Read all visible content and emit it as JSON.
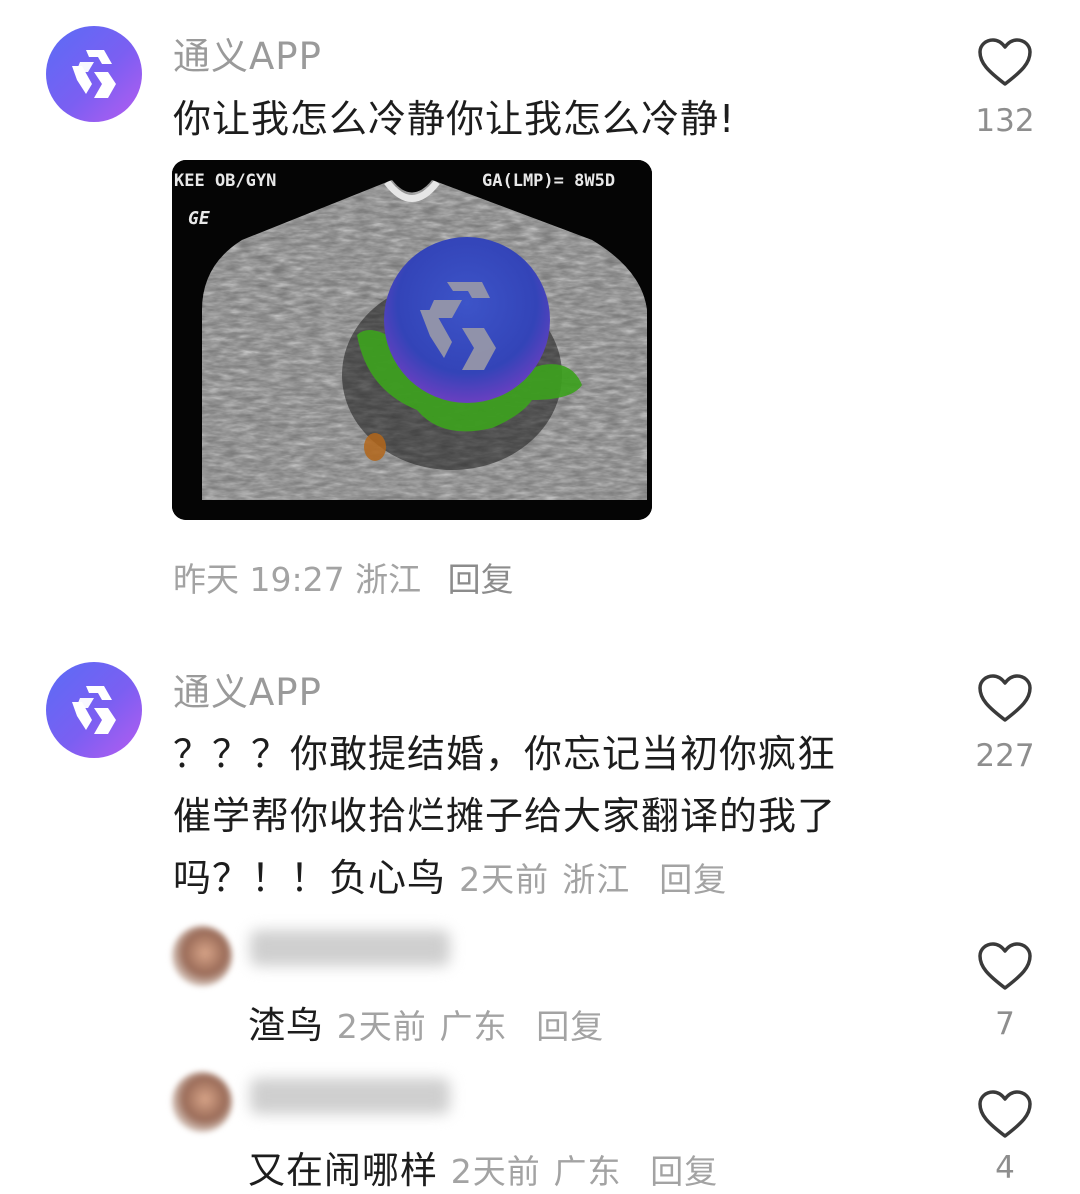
{
  "comments": [
    {
      "user": "通义APP",
      "text": "你让我怎么冷静你让我怎么冷静!",
      "time": "昨天 19:27",
      "location": "浙江",
      "reply_label": "回复",
      "likes": "132",
      "image": {
        "overlay_left": "KEE OB/GYN",
        "overlay_right": "GA(LMP)= 8W5D",
        "overlay_logo": "GE"
      }
    },
    {
      "user": "通义APP",
      "text": "？？？你敢提结婚，你忘记当初你疯狂催学帮你收拾烂摊子给大家翻译的我了吗？！！负心鸟",
      "line1": "？？？你敢提结婚，你忘记当初你疯狂",
      "line2": "催学帮你收拾烂摊子给大家翻译的我了",
      "line3": "吗？！！负心鸟",
      "time": "2天前",
      "location": "浙江",
      "reply_label": "回复",
      "likes": "227"
    }
  ],
  "replies": [
    {
      "text": "渣鸟",
      "time": "2天前",
      "location": "广东",
      "reply_label": "回复",
      "likes": "7"
    },
    {
      "text": "又在闹哪样",
      "time": "2天前",
      "location": "广东",
      "reply_label": "回复",
      "likes": "4"
    }
  ],
  "icons": {
    "avatar": "tongyi-logo-icon",
    "like": "heart-outline-icon"
  },
  "colors": {
    "avatar_gradient_start": "#5a6cf6",
    "avatar_gradient_end": "#b65cf0",
    "meta_gray": "#a3a3a3"
  }
}
